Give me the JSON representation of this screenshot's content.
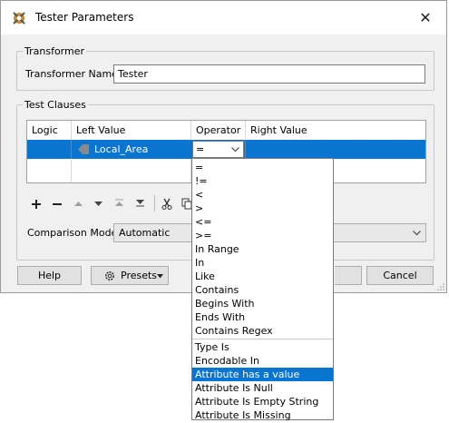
{
  "window": {
    "title": "Tester Parameters",
    "close_glyph": "✕"
  },
  "transformer": {
    "group_label": "Transformer",
    "name_label": "Transformer Name:",
    "name_value": "Tester"
  },
  "clauses": {
    "group_label": "Test Clauses",
    "columns": [
      "Logic",
      "Left Value",
      "Operator",
      "Right Value"
    ],
    "row": {
      "left_value": "Local_Area",
      "operator": "="
    }
  },
  "toolbar": {
    "icons": [
      "add-icon",
      "remove-icon",
      "move-up-icon",
      "move-down-icon",
      "move-top-icon",
      "move-bottom-icon",
      "cut-icon",
      "copy-icon"
    ]
  },
  "comparison": {
    "label": "Comparison Mode:",
    "value": "Automatic"
  },
  "buttons": {
    "help": "Help",
    "presets": "Presets",
    "cancel": "Cancel"
  },
  "operator_menu": {
    "group1": [
      "=",
      "!=",
      "<",
      ">",
      "<=",
      ">=",
      "In Range",
      "In",
      "Like",
      "Contains",
      "Begins With",
      "Ends With",
      "Contains Regex"
    ],
    "group2": [
      "Type Is",
      "Encodable In",
      "Attribute has a value",
      "Attribute Is Null",
      "Attribute Is Empty String",
      "Attribute Is Missing"
    ],
    "selected": "Attribute has a value"
  },
  "colors": {
    "selection": "#0a74d1"
  }
}
